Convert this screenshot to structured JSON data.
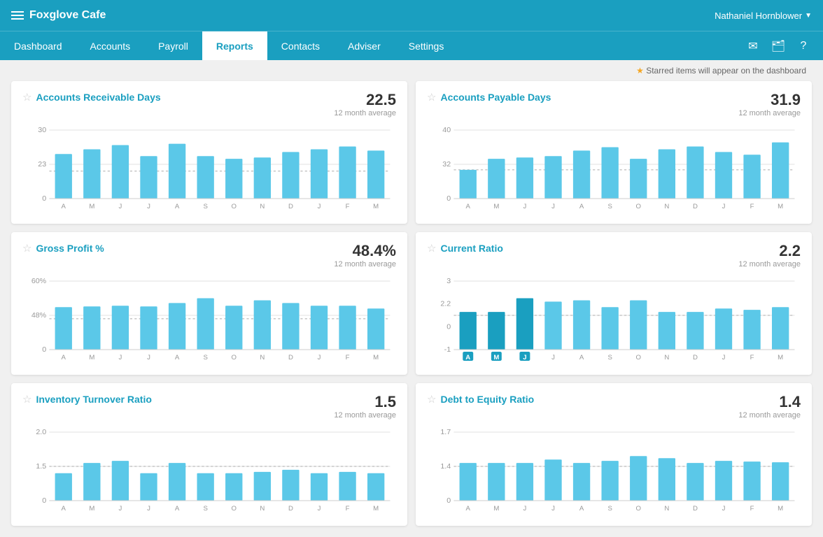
{
  "app": {
    "logo": "Foxglove Cafe",
    "user": "Nathaniel Hornblower"
  },
  "nav": {
    "items": [
      {
        "label": "Dashboard",
        "active": false
      },
      {
        "label": "Accounts",
        "active": false
      },
      {
        "label": "Payroll",
        "active": false
      },
      {
        "label": "Reports",
        "active": true
      },
      {
        "label": "Contacts",
        "active": false
      },
      {
        "label": "Adviser",
        "active": false
      },
      {
        "label": "Settings",
        "active": false
      }
    ]
  },
  "star_bar": "Starred items will appear on the dashboard",
  "cards": [
    {
      "title": "Accounts Receivable Days",
      "value": "22.5",
      "subtitle": "12 month average",
      "y_labels": [
        "30",
        "23",
        "0"
      ],
      "avg_pct": 40,
      "months": [
        "A",
        "M",
        "J",
        "J",
        "A",
        "S",
        "O",
        "N",
        "D",
        "J",
        "F",
        "M"
      ],
      "bars": [
        65,
        72,
        78,
        62,
        80,
        62,
        58,
        60,
        68,
        72,
        76,
        70
      ]
    },
    {
      "title": "Accounts Payable Days",
      "value": "31.9",
      "subtitle": "12 month average",
      "y_labels": [
        "40",
        "32",
        "0"
      ],
      "avg_pct": 42,
      "months": [
        "A",
        "M",
        "J",
        "J",
        "A",
        "S",
        "O",
        "N",
        "D",
        "J",
        "F",
        "M"
      ],
      "bars": [
        42,
        58,
        60,
        62,
        70,
        75,
        58,
        72,
        76,
        68,
        64,
        82
      ]
    },
    {
      "title": "Gross Profit %",
      "value": "48.4%",
      "subtitle": "12 month average",
      "y_labels": [
        "60%",
        "48%",
        "0"
      ],
      "avg_pct": 45,
      "months": [
        "A",
        "M",
        "J",
        "J",
        "A",
        "S",
        "O",
        "N",
        "D",
        "J",
        "F",
        "M"
      ],
      "bars": [
        62,
        63,
        64,
        63,
        68,
        75,
        64,
        72,
        68,
        64,
        64,
        60
      ],
      "selected": []
    },
    {
      "title": "Current Ratio",
      "value": "2.2",
      "subtitle": "12 month average",
      "y_labels": [
        "3",
        "2.2",
        "0",
        "-1"
      ],
      "avg_pct": 50,
      "months": [
        "A",
        "M",
        "J",
        "J",
        "A",
        "S",
        "O",
        "N",
        "D",
        "J",
        "F",
        "M"
      ],
      "bars": [
        55,
        55,
        75,
        70,
        72,
        62,
        72,
        55,
        55,
        60,
        58,
        62
      ],
      "selected": [
        0,
        1,
        2
      ]
    },
    {
      "title": "Inventory Turnover Ratio",
      "value": "1.5",
      "subtitle": "12 month average",
      "y_labels": [
        "2.0",
        "1.5",
        "0"
      ],
      "avg_pct": 50,
      "months": [
        "A",
        "M",
        "J",
        "J",
        "A",
        "S",
        "O",
        "N",
        "D",
        "J",
        "F",
        "M"
      ],
      "bars": [
        40,
        55,
        58,
        40,
        55,
        40,
        40,
        42,
        45,
        40,
        42,
        40
      ]
    },
    {
      "title": "Debt to Equity Ratio",
      "value": "1.4",
      "subtitle": "12 month average",
      "y_labels": [
        "1.7",
        "1.4",
        "0"
      ],
      "avg_pct": 50,
      "months": [
        "A",
        "M",
        "J",
        "J",
        "A",
        "S",
        "O",
        "N",
        "D",
        "J",
        "F",
        "M"
      ],
      "bars": [
        55,
        55,
        55,
        60,
        55,
        58,
        65,
        62,
        55,
        58,
        57,
        56
      ]
    }
  ]
}
